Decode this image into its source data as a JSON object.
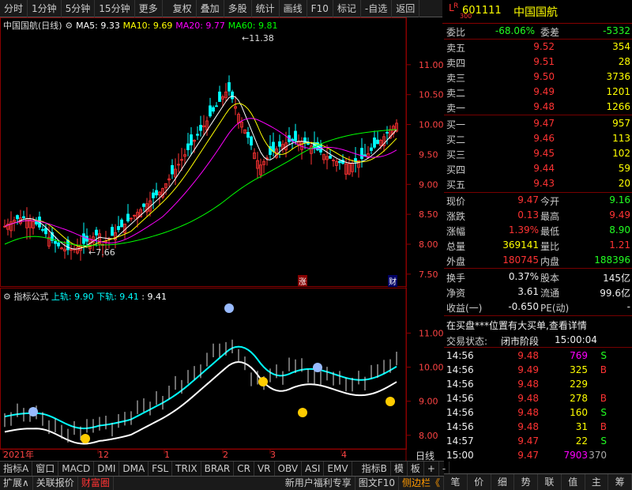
{
  "toolbar": [
    "分时",
    "1分钟",
    "5分钟",
    "15分钟",
    "更多",
    "复权",
    "叠加",
    "多股",
    "统计",
    "画线",
    "F10",
    "标记",
    "-自选",
    "返回"
  ],
  "stock": {
    "code": "601111",
    "name": "中国国航",
    "l_label": "L",
    "r_label": "R",
    "r_sub": "300"
  },
  "main_chart": {
    "title": "中国国航(日线)",
    "ma5": "MA5: 9.33",
    "ma10": "MA10: 9.69",
    "ma20": "MA20: 9.77",
    "ma60": "MA60: 9.81",
    "high_mark": "11.38",
    "low_mark": "7.66",
    "y_ticks": [
      "11.00",
      "10.50",
      "10.00",
      "9.50",
      "9.00",
      "8.50",
      "8.00",
      "7.50"
    ],
    "badge_zhang": "涨",
    "badge_cai": "财",
    "colors": {
      "ma5": "#ffffff",
      "ma10": "#ffff00",
      "ma20": "#ff00ff",
      "ma60": "#00ff00",
      "up": "#ff3333",
      "down": "#00ffff"
    }
  },
  "sub_chart": {
    "title": "指标公式",
    "upper": "上轨: 9.90",
    "lower": "下轨: 9.41",
    "value": ": 9.41",
    "y_ticks": [
      "11.00",
      "10.00",
      "9.00",
      "8.00"
    ]
  },
  "x_axis": {
    "labels": [
      "2021年",
      "12",
      "1",
      "2",
      "3",
      "4"
    ],
    "period": "日线"
  },
  "order_book": {
    "weibi_label": "委比",
    "weibi": "-68.06%",
    "weicha_label": "委差",
    "weicha": "-5332",
    "asks": [
      {
        "label": "卖五",
        "price": "9.52",
        "vol": "354"
      },
      {
        "label": "卖四",
        "price": "9.51",
        "vol": "28"
      },
      {
        "label": "卖三",
        "price": "9.50",
        "vol": "3736"
      },
      {
        "label": "卖二",
        "price": "9.49",
        "vol": "1201"
      },
      {
        "label": "卖一",
        "price": "9.48",
        "vol": "1266"
      }
    ],
    "bids": [
      {
        "label": "买一",
        "price": "9.47",
        "vol": "957"
      },
      {
        "label": "买二",
        "price": "9.46",
        "vol": "113"
      },
      {
        "label": "买三",
        "price": "9.45",
        "vol": "102"
      },
      {
        "label": "买四",
        "price": "9.44",
        "vol": "59"
      },
      {
        "label": "买五",
        "price": "9.43",
        "vol": "20"
      }
    ]
  },
  "quote": {
    "rows": [
      {
        "l1": "现价",
        "v1": "9.47",
        "l2": "今开",
        "v2": "9.16"
      },
      {
        "l1": "涨跌",
        "v1": "0.13",
        "l2": "最高",
        "v2": "9.49"
      },
      {
        "l1": "涨幅",
        "v1": "1.39%",
        "l2": "最低",
        "v2": "8.90"
      },
      {
        "l1": "总量",
        "v1": "369141",
        "l2": "量比",
        "v2": "1.21"
      },
      {
        "l1": "外盘",
        "v1": "180745",
        "l2": "内盘",
        "v2": "188396"
      }
    ],
    "rows2": [
      {
        "l1": "换手",
        "v1": "0.37%",
        "l2": "股本",
        "v2": "145亿"
      },
      {
        "l1": "净资",
        "v1": "3.61",
        "l2": "流通",
        "v2": "99.6亿"
      },
      {
        "l1": "收益(一)",
        "v1": "-0.650",
        "l2": "PE(动)",
        "v2": "-"
      }
    ],
    "notice": "在买盘***位置有大买单,查看详情",
    "status_label": "交易状态:",
    "status": "闭市阶段",
    "status_time": "15:00:04"
  },
  "ticks": [
    {
      "time": "14:56",
      "price": "9.48",
      "vol": "769",
      "bs": "S"
    },
    {
      "time": "14:56",
      "price": "9.49",
      "vol": "325",
      "bs": "B"
    },
    {
      "time": "14:56",
      "price": "9.48",
      "vol": "229",
      "bs": ""
    },
    {
      "time": "14:56",
      "price": "9.48",
      "vol": "278",
      "bs": "B"
    },
    {
      "time": "14:56",
      "price": "9.48",
      "vol": "160",
      "bs": "S"
    },
    {
      "time": "14:56",
      "price": "9.48",
      "vol": "31",
      "bs": "B"
    },
    {
      "time": "14:57",
      "price": "9.47",
      "vol": "22",
      "bs": "S"
    },
    {
      "time": "15:00",
      "price": "9.47",
      "vol": "7903",
      "bs": "370"
    }
  ],
  "bottom_tabs1": [
    "指标A",
    "窗口",
    "MACD",
    "DMI",
    "DMA",
    "FSL",
    "TRIX",
    "BRAR",
    "CR",
    "VR",
    "OBV",
    "ASI",
    "EMV",
    "",
    "指标B",
    "模",
    "板",
    "+",
    "-"
  ],
  "bottom_tabs2": [
    "扩展∧",
    "关联报价",
    "财富圈",
    "新用户福利专享",
    "图文F10",
    "侧边栏《"
  ],
  "right_tabs": [
    "笔",
    "价",
    "细",
    "势",
    "联",
    "值",
    "主",
    "筹"
  ]
}
